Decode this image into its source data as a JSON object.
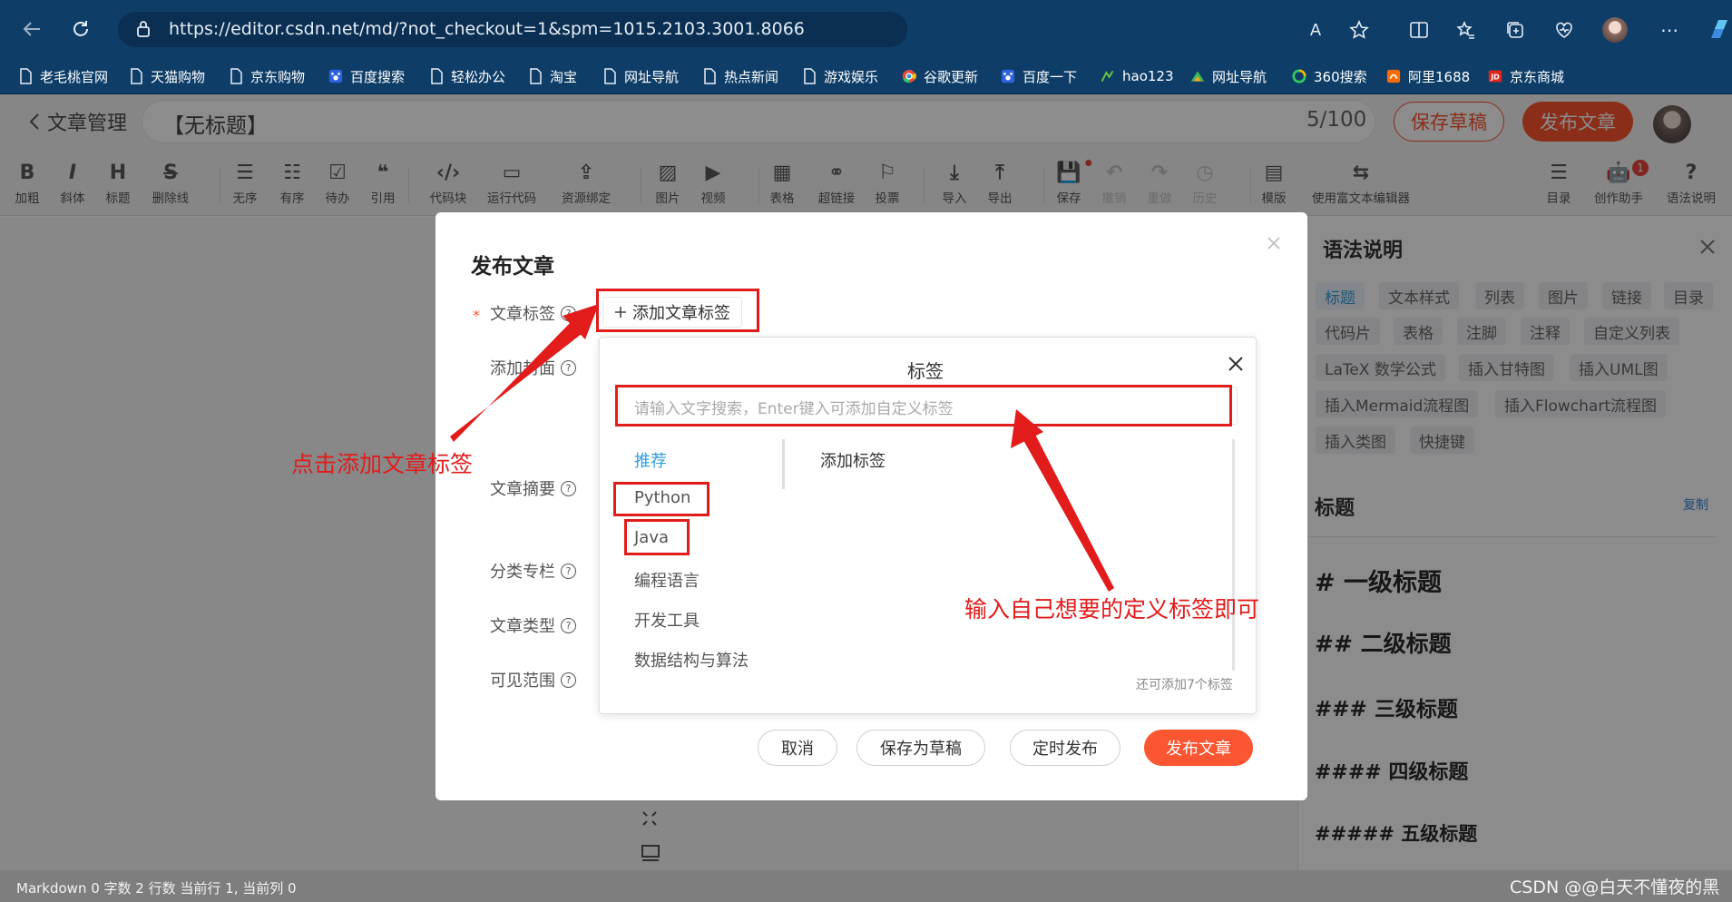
{
  "browser": {
    "url": "https://editor.csdn.net/md/?not_checkout=1&spm=1015.2103.3001.8066",
    "read_aloud_label": "A",
    "bookmarks": [
      {
        "label": "老毛桃官网",
        "icon": "page-icon"
      },
      {
        "label": "天猫购物",
        "icon": "page-icon"
      },
      {
        "label": "京东购物",
        "icon": "page-icon"
      },
      {
        "label": "百度搜索",
        "icon": "baidu-icon"
      },
      {
        "label": "轻松办公",
        "icon": "page-icon"
      },
      {
        "label": "淘宝",
        "icon": "page-icon"
      },
      {
        "label": "网址导航",
        "icon": "page-icon"
      },
      {
        "label": "热点新闻",
        "icon": "page-icon"
      },
      {
        "label": "游戏娱乐",
        "icon": "page-icon"
      },
      {
        "label": "谷歌更新",
        "icon": "chrome-icon"
      },
      {
        "label": "百度一下",
        "icon": "baidu-icon"
      },
      {
        "label": "hao123",
        "icon": "hao123-icon"
      },
      {
        "label": "网址导航",
        "icon": "nav-site-icon"
      },
      {
        "label": "360搜索",
        "icon": "360-icon"
      },
      {
        "label": "阿里1688",
        "icon": "1688-icon"
      },
      {
        "label": "京东商城",
        "icon": "jd-icon"
      }
    ]
  },
  "header": {
    "back_label": "文章管理",
    "title": "【无标题】",
    "title_count": "5/100",
    "save_draft": "保存草稿",
    "publish": "发布文章"
  },
  "toolbar": {
    "items": [
      {
        "glyph": "B",
        "label": "加粗"
      },
      {
        "glyph": "I",
        "label": "斜体"
      },
      {
        "glyph": "H",
        "label": "标题"
      },
      {
        "glyph": "S",
        "label": "删除线"
      },
      {
        "glyph": "☰",
        "label": "无序"
      },
      {
        "glyph": "☷",
        "label": "有序"
      },
      {
        "glyph": "☑",
        "label": "待办"
      },
      {
        "glyph": "❝",
        "label": "引用"
      },
      {
        "glyph": "‹/›",
        "label": "代码块"
      },
      {
        "glyph": "▭",
        "label": "运行代码"
      },
      {
        "glyph": "⇪",
        "label": "资源绑定"
      },
      {
        "glyph": "▨",
        "label": "图片"
      },
      {
        "glyph": "▶",
        "label": "视频"
      },
      {
        "glyph": "▦",
        "label": "表格"
      },
      {
        "glyph": "⚭",
        "label": "超链接"
      },
      {
        "glyph": "⚐",
        "label": "投票"
      },
      {
        "glyph": "⤓",
        "label": "导入"
      },
      {
        "glyph": "⤒",
        "label": "导出"
      },
      {
        "glyph": "💾",
        "label": "保存"
      },
      {
        "glyph": "↶",
        "label": "撤销"
      },
      {
        "glyph": "↷",
        "label": "重做"
      },
      {
        "glyph": "◷",
        "label": "历史"
      },
      {
        "glyph": "▤",
        "label": "模版"
      },
      {
        "glyph": "⇆",
        "label": "使用富文本编辑器"
      },
      {
        "glyph": "☰",
        "label": "目录"
      },
      {
        "glyph": "🤖",
        "label": "创作助手"
      },
      {
        "glyph": "?",
        "label": "语法说明"
      }
    ],
    "assistant_badge": "1"
  },
  "right_panel": {
    "title": "语法说明",
    "chips": [
      "标题",
      "文本样式",
      "列表",
      "图片",
      "链接",
      "目录",
      "代码片",
      "表格",
      "注脚",
      "注释",
      "自定义列表",
      "LaTeX 数学公式",
      "插入甘特图",
      "插入UML图",
      "插入Mermaid流程图",
      "插入Flowchart流程图",
      "插入类图",
      "快捷键"
    ],
    "section_title": "标题",
    "copy_label": "复制",
    "headings": [
      "# 一级标题",
      "## 二级标题",
      "### 三级标题",
      "#### 四级标题",
      "##### 五级标题"
    ]
  },
  "modal": {
    "title": "发布文章",
    "required_mark": "*",
    "fields": {
      "tags": "文章标签",
      "cover": "添加封面",
      "summary": "文章摘要",
      "category": "分类专栏",
      "type": "文章类型",
      "visibility": "可见范围"
    },
    "add_tag_label": "添加文章标签",
    "buttons": {
      "cancel": "取消",
      "save_draft": "保存为草稿",
      "schedule": "定时发布",
      "publish": "发布文章"
    }
  },
  "tag_popup": {
    "title": "标签",
    "search_placeholder": "请输入文字搜索，Enter键入可添加自定义标签",
    "categories": [
      "推荐",
      "Python",
      "Java",
      "编程语言",
      "开发工具",
      "数据结构与算法"
    ],
    "add_label": "添加标签",
    "remaining": "还可添加7个标签"
  },
  "annotations": {
    "left": "点击添加文章标签",
    "right": "输入自己想要的定义标签即可"
  },
  "statusbar": {
    "text": "Markdown  0 字数  2 行数  当前行 1, 当前列 0"
  },
  "watermark": "CSDN @@白天不懂夜的黑",
  "colors": {
    "accent": "#fc5531",
    "link": "#349edf",
    "annotation": "#e21b1b",
    "chrome": "#0e3d68"
  }
}
